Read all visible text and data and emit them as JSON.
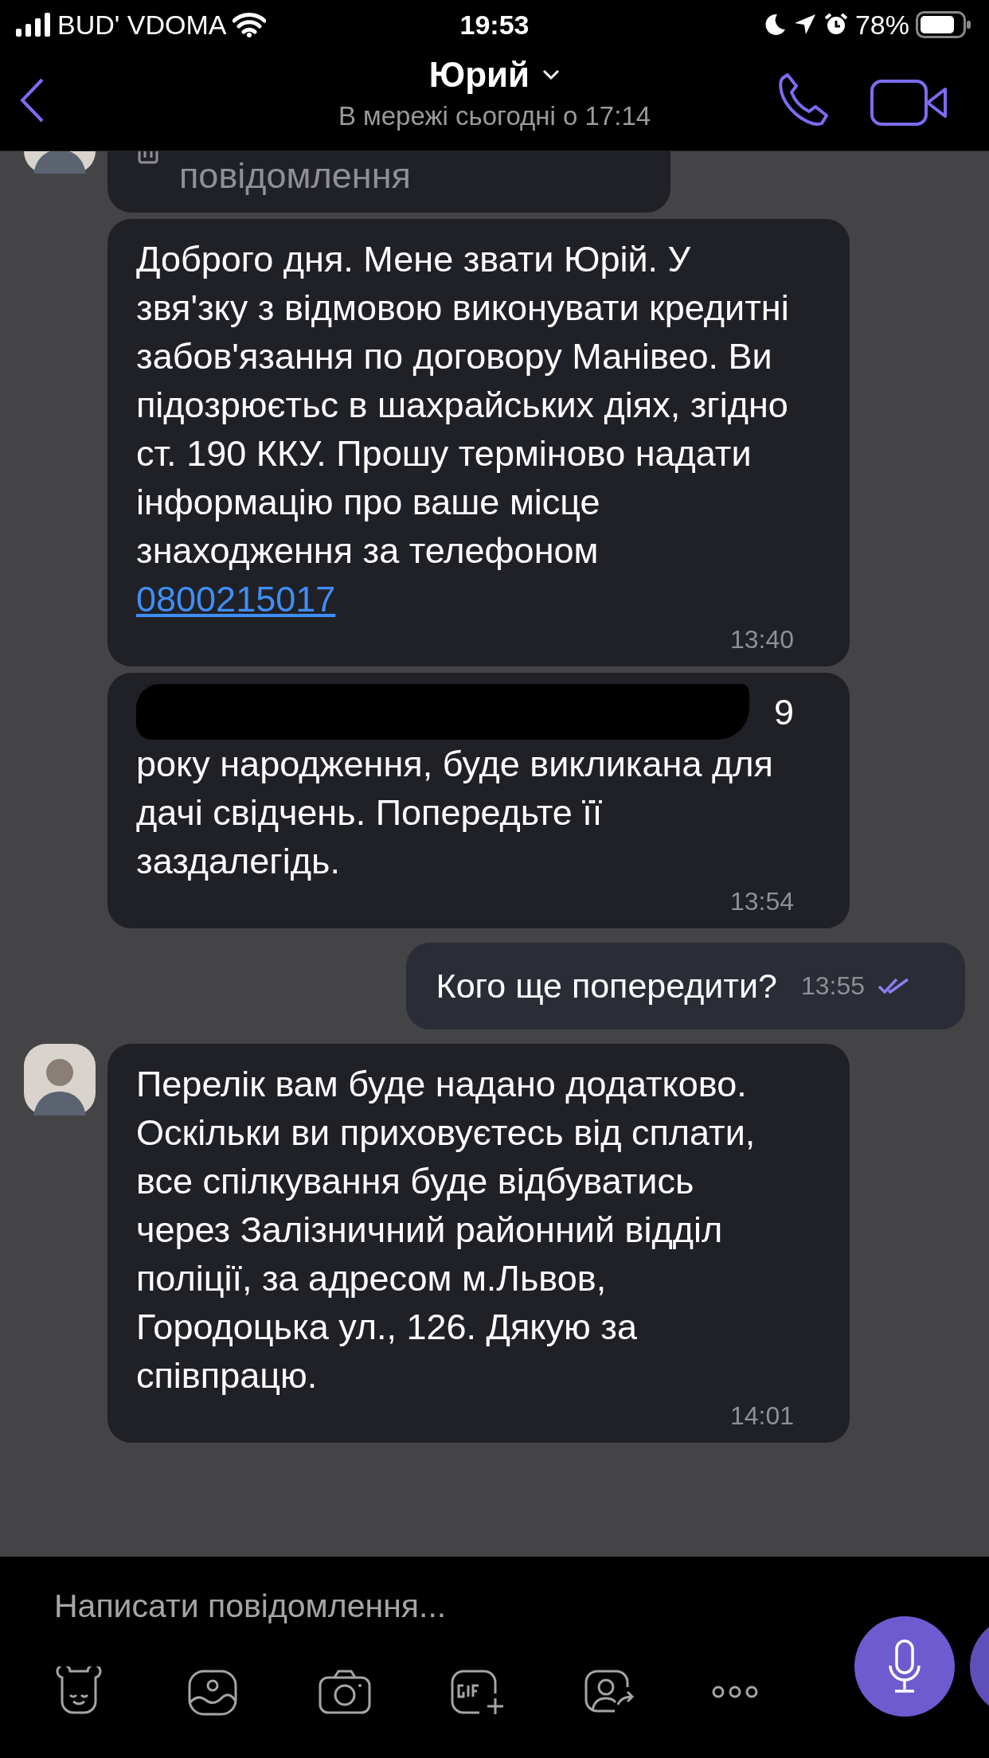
{
  "status_bar": {
    "carrier": "BUD' VDOMA",
    "time": "19:53",
    "battery": "78%"
  },
  "header": {
    "name": "Юрий",
    "status": "В мережі сьогодні о 17:14"
  },
  "messages": [
    {
      "kind": "deleted",
      "avatar": true,
      "text": "повідомлення"
    },
    {
      "kind": "incoming",
      "avatar": false,
      "text": "Доброго дня. Мене звати Юрій. У звя'зку з відмовою виконувати кредитні забов'язання по договору Манівео. Ви підозрюєтьс в шахрайських діях, згідно ст. 190 ККУ. Прошу терміново надати інформацію про ваше місце знаходження за телефоном ",
      "link": "0800215017",
      "time": "13:40"
    },
    {
      "kind": "redacted",
      "avatar": false,
      "fragment": "9",
      "text": "року народження, буде викликана для дачі свідчень. Попередьте її заздалегідь.",
      "time": "13:54"
    },
    {
      "kind": "outgoing",
      "text": "Кого ще попередити?",
      "time": "13:55",
      "read": true
    },
    {
      "kind": "incoming",
      "avatar": true,
      "text": "Перелік вам буде надано додатково. Оскільки ви приховуєтесь від сплати, все спілкування буде відбуватись через Залізничний районний відділ поліції, за адресом м.Львов, Городоцька ул., 126. Дякую за співпрацю.",
      "time": "14:01"
    }
  ],
  "composer": {
    "placeholder": "Написати повідомлення..."
  }
}
